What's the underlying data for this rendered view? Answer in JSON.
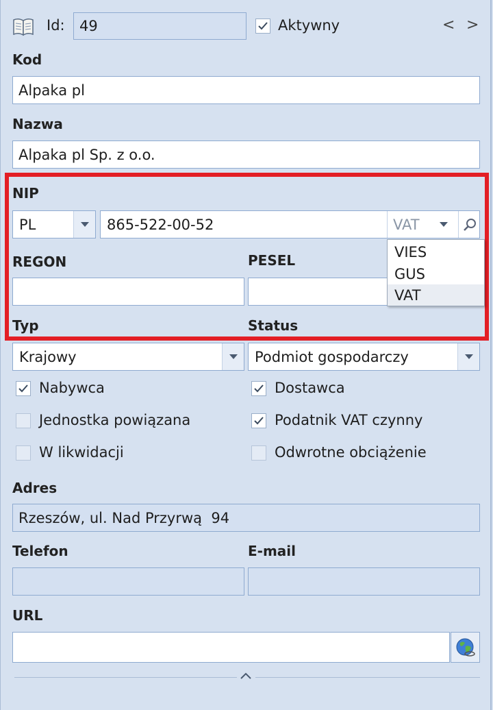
{
  "header": {
    "id_label": "Id:",
    "id_value": "49",
    "active_label": "Aktywny",
    "active_checked": true,
    "prev_symbol": "<",
    "next_symbol": ">"
  },
  "kod": {
    "label": "Kod",
    "value": "Alpaka pl"
  },
  "nazwa": {
    "label": "Nazwa",
    "value": "Alpaka pl Sp. z o.o."
  },
  "nip": {
    "label": "NIP",
    "country": "PL",
    "value": "865-522-00-52",
    "source": "VAT",
    "options": [
      "VIES",
      "GUS",
      "VAT"
    ],
    "selected_option": "VAT"
  },
  "regon": {
    "label": "REGON",
    "value": ""
  },
  "pesel": {
    "label": "PESEL",
    "value": ""
  },
  "typ": {
    "label": "Typ",
    "value": "Krajowy"
  },
  "status": {
    "label": "Status",
    "value": "Podmiot gospodarczy"
  },
  "checkboxes": {
    "nabywca": {
      "label": "Nabywca",
      "checked": true
    },
    "dostawca": {
      "label": "Dostawca",
      "checked": true
    },
    "jednostka": {
      "label": "Jednostka powiązana",
      "checked": false
    },
    "podatnik": {
      "label": "Podatnik VAT czynny",
      "checked": true
    },
    "likwidacja": {
      "label": "W likwidacji",
      "checked": false
    },
    "odwrotne": {
      "label": "Odwrotne obciążenie",
      "checked": false
    }
  },
  "adres": {
    "label": "Adres",
    "value": "Rzeszów, ul. Nad Przyrwą  94"
  },
  "telefon": {
    "label": "Telefon",
    "value": ""
  },
  "email": {
    "label": "E-mail",
    "value": ""
  },
  "url": {
    "label": "URL",
    "value": ""
  },
  "colors": {
    "highlight": "#e31e25",
    "panel": "#d6e1f0",
    "border": "#8eaad0"
  },
  "icons": {
    "book": "book-icon",
    "globe": "globe-icon",
    "search": "search-icon",
    "collapse": "chevron-up-icon"
  }
}
